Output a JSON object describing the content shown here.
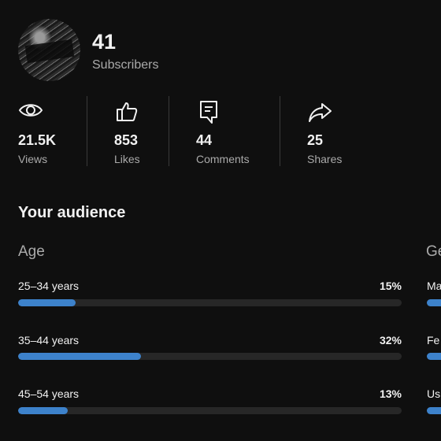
{
  "channel": {
    "subscribers_count": "41",
    "subscribers_label": "Subscribers"
  },
  "stats": [
    {
      "icon": "eye-icon",
      "value": "21.5K",
      "label": "Views"
    },
    {
      "icon": "thumbs-up-icon",
      "value": "853",
      "label": "Likes"
    },
    {
      "icon": "comment-icon",
      "value": "44",
      "label": "Comments"
    },
    {
      "icon": "share-icon",
      "value": "25",
      "label": "Shares"
    }
  ],
  "audience": {
    "title": "Your audience",
    "age": {
      "title": "Age",
      "rows": [
        {
          "label": "25–34 years",
          "percent_text": "15%",
          "fraction": 0.15
        },
        {
          "label": "35–44 years",
          "percent_text": "32%",
          "fraction": 0.32
        },
        {
          "label": "45–54 years",
          "percent_text": "13%",
          "fraction": 0.13
        }
      ]
    },
    "gender": {
      "title": "Ge",
      "rows": [
        {
          "label": "Ma"
        },
        {
          "label": "Fe"
        },
        {
          "label": "Us"
        }
      ]
    }
  },
  "colors": {
    "background": "#0f0f0f",
    "bar_fill": "#3d82cb",
    "bar_track": "#272727",
    "secondary_text": "#aaaaaa"
  }
}
